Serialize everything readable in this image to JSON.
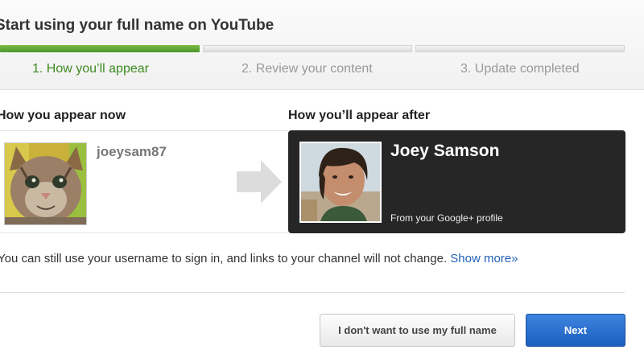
{
  "header": {
    "title": "Start using your full name on YouTube"
  },
  "progress": {
    "completed_fraction": 0.33,
    "steps": [
      {
        "label": "1. How you’ll appear",
        "state": "active"
      },
      {
        "label": "2. Review your content",
        "state": "inactive"
      },
      {
        "label": "3. Update completed",
        "state": "inactive"
      }
    ]
  },
  "current": {
    "heading": "How you appear now",
    "username": "joeysam87",
    "avatar_icon": "cat-photo"
  },
  "after": {
    "heading": "How you’ll appear after",
    "full_name": "Joey Samson",
    "source_note": "From your Google+ profile",
    "avatar_icon": "person-photo"
  },
  "transition_icon": "arrow-right-icon",
  "note": {
    "text": "You can still use your username to sign in, and links to your channel will not change.",
    "link": "Show more»"
  },
  "buttons": {
    "decline_label": "I don't want to use my full name",
    "next_label": "Next"
  },
  "colors": {
    "progress_done": "#5ea534",
    "active_step": "#3f8a22",
    "link": "#2262b7",
    "primary_button": "#2b71d0",
    "card_bg": "#262626"
  }
}
